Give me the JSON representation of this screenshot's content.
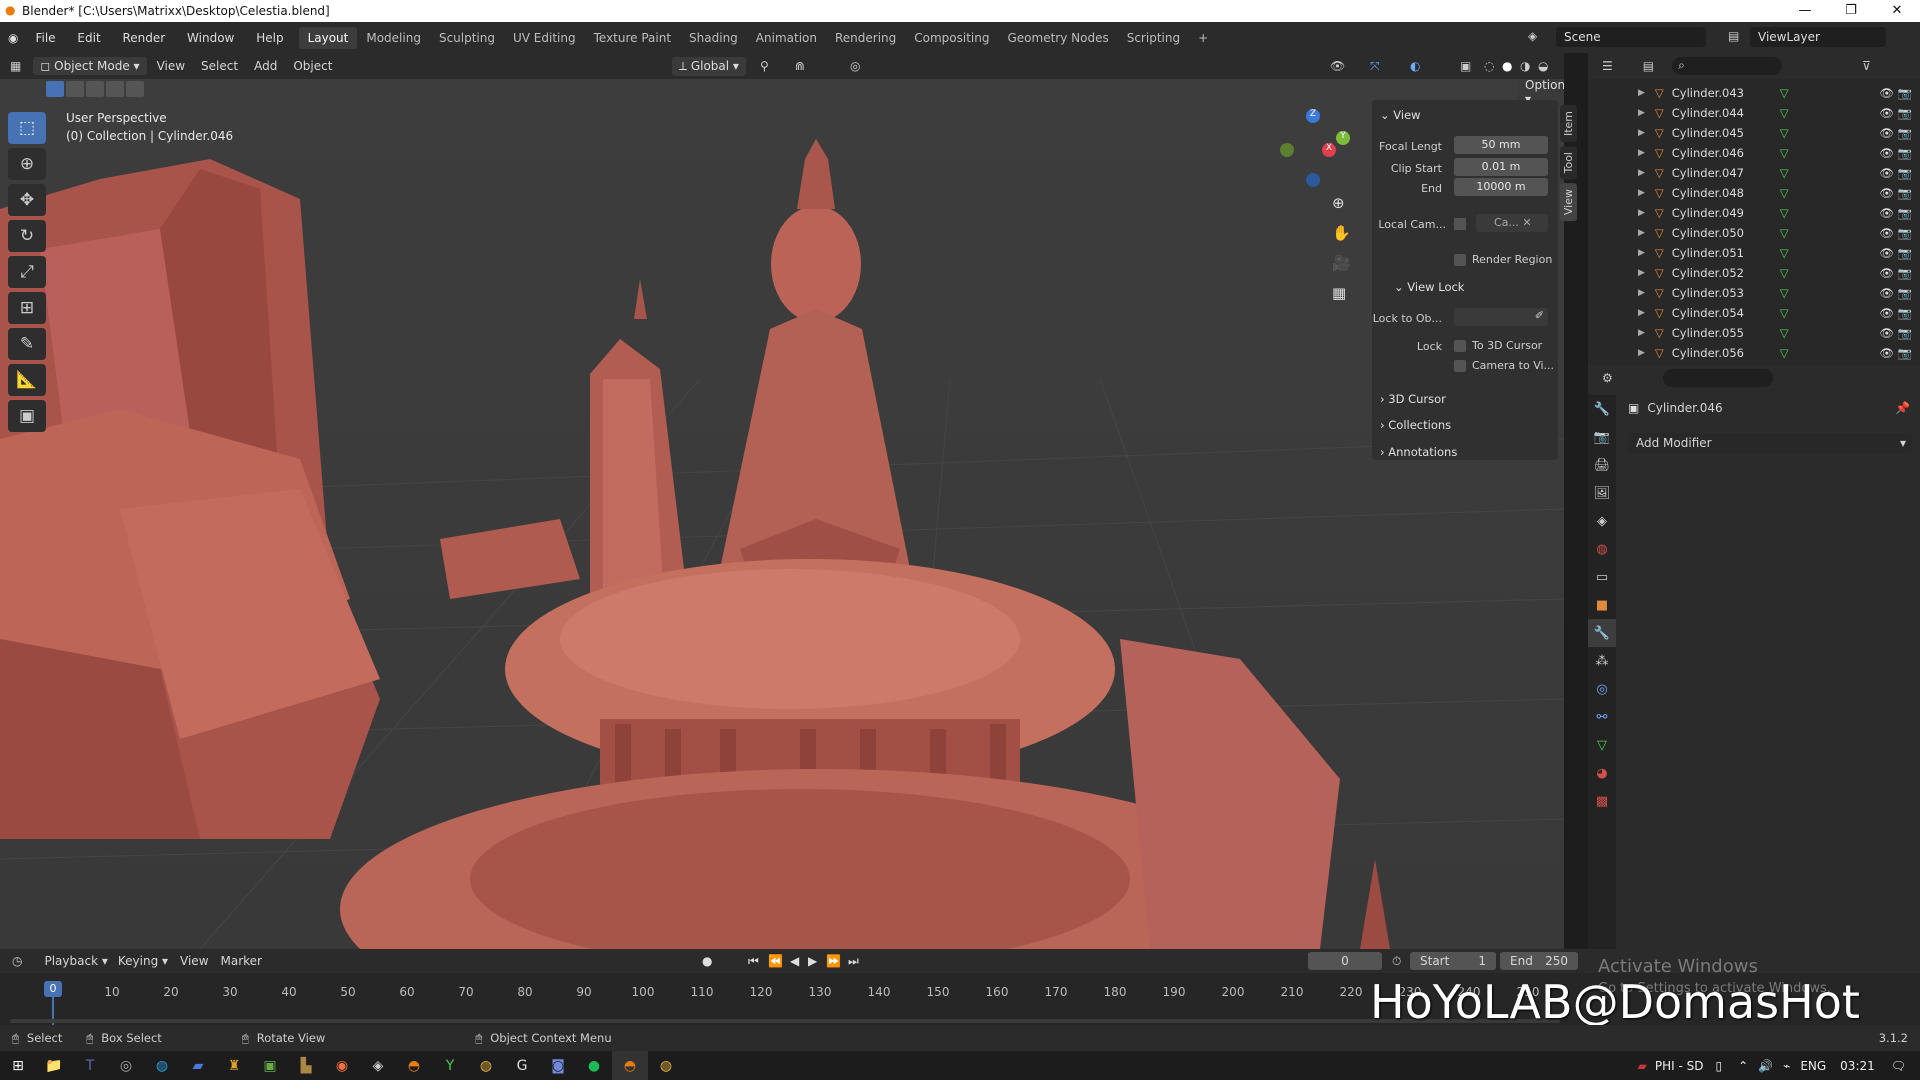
{
  "titlebar": {
    "title": "Blender* [C:\\Users\\Matrixx\\Desktop\\Celestia.blend]"
  },
  "menu": [
    "File",
    "Edit",
    "Render",
    "Window",
    "Help"
  ],
  "workspaces": [
    "Layout",
    "Modeling",
    "Sculpting",
    "UV Editing",
    "Texture Paint",
    "Shading",
    "Animation",
    "Rendering",
    "Compositing",
    "Geometry Nodes",
    "Scripting",
    "+"
  ],
  "active_workspace": "Layout",
  "scene": {
    "name": "Scene",
    "view_layer": "ViewLayer"
  },
  "viewport_header": {
    "mode": "Object Mode",
    "view": "View",
    "select": "Select",
    "add": "Add",
    "object": "Object",
    "orientation": "Global",
    "options": "Options"
  },
  "viewport": {
    "perspective": "User Perspective",
    "collection_info": "(0) Collection | Cylinder.046"
  },
  "npanel": {
    "view_header": "View",
    "focal_label": "Focal Lengt",
    "focal_value": "50 mm",
    "clip_start_label": "Clip Start",
    "clip_start_value": "0.01 m",
    "end_label": "End",
    "end_value": "10000 m",
    "local_cam_label": "Local Cam...",
    "local_cam_value": "Ca...",
    "render_region": "Render Region",
    "view_lock_header": "View Lock",
    "lock_to_label": "Lock to Ob...",
    "lock_label": "Lock",
    "to_3d_cursor": "To 3D Cursor",
    "camera_to_view": "Camera to Vi...",
    "cursor_header": "3D Cursor",
    "collections_header": "Collections",
    "annotations_header": "Annotations",
    "tabs": [
      "Item",
      "Tool",
      "View"
    ]
  },
  "outliner": {
    "items": [
      "Cylinder.043",
      "Cylinder.044",
      "Cylinder.045",
      "Cylinder.046",
      "Cylinder.047",
      "Cylinder.048",
      "Cylinder.049",
      "Cylinder.050",
      "Cylinder.051",
      "Cylinder.052",
      "Cylinder.053",
      "Cylinder.054",
      "Cylinder.055",
      "Cylinder.056"
    ]
  },
  "properties": {
    "object_name": "Cylinder.046",
    "add_modifier": "Add Modifier"
  },
  "timeline": {
    "menus": [
      "Playback",
      "Keying",
      "View",
      "Marker"
    ],
    "current_frame": "0",
    "start_label": "Start",
    "start_value": "1",
    "end_label": "End",
    "end_value": "250",
    "ruler": [
      "0",
      "10",
      "20",
      "30",
      "40",
      "50",
      "60",
      "70",
      "80",
      "90",
      "100",
      "110",
      "120",
      "130",
      "140",
      "150",
      "160",
      "170",
      "180",
      "190",
      "200",
      "210",
      "220",
      "230",
      "240",
      "250"
    ]
  },
  "statusbar": {
    "select": "Select",
    "box_select": "Box Select",
    "rotate_view": "Rotate View",
    "context_menu": "Object Context Menu",
    "version": "3.1.2"
  },
  "activate_windows": {
    "title": "Activate Windows",
    "subtitle": "Go to Settings to activate Windows."
  },
  "watermark": "HoYoLAB@DomasHot",
  "taskbar": {
    "lang_region": "PHI - SD",
    "lang": "ENG",
    "time": "03:21"
  },
  "colors": {
    "accent": "#4772b3",
    "model": "#b65a4e",
    "outliner_icon": "#e08a3c"
  }
}
